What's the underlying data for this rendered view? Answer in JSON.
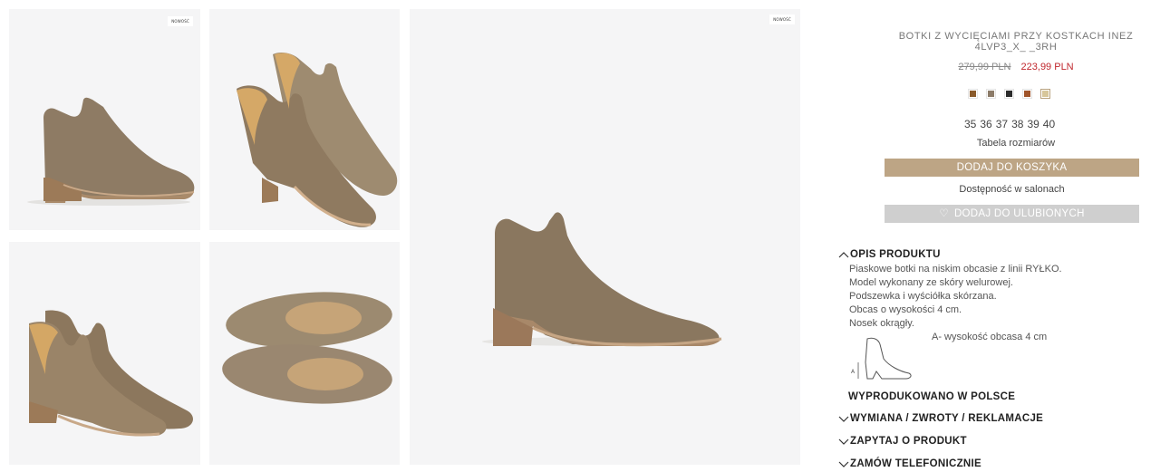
{
  "gallery": {
    "badge": "NOWOŚĆ"
  },
  "product": {
    "title": "BOTKI Z WYCIĘCIAMI PRZY KOSTKACH INEZ 4LVP3_X_ _3RH",
    "old_price": "279,99 PLN",
    "new_price": "223,99 PLN",
    "colors": [
      "#8a5a2b",
      "#8c7b68",
      "#2b2b2b",
      "#a0542a",
      "#d7c69a"
    ],
    "selected_color_index": 4,
    "sizes": [
      "35",
      "36",
      "37",
      "38",
      "39",
      "40"
    ],
    "size_chart_link": "Tabela rozmiarów",
    "add_to_cart": "DODAJ DO KOSZYKA",
    "availability_link": "Dostępność w salonach",
    "add_to_favorites": "DODAJ DO ULUBIONYCH",
    "accent_color": "#bda585",
    "sale_color": "#c0272d"
  },
  "details": {
    "description_title": "OPIS PRODUKTU",
    "description_lines": [
      "Piaskowe botki na niskim obcasie z linii RYŁKO.",
      "Model wykonany ze skóry welurowej.",
      "Podszewka i wyściółka skórzana.",
      "Obcas o wysokości 4 cm.",
      "Nosek okrągły."
    ],
    "heel_note": "A- wysokość obcasa 4 cm",
    "diagram_label": "A",
    "made_in": "WYPRODUKOWANO W POLSCE",
    "returns": "WYMIANA / ZWROTY / REKLAMACJE",
    "ask": "ZAPYTAJ O PRODUKT",
    "phone_order": "ZAMÓW TELEFONICZNIE"
  }
}
